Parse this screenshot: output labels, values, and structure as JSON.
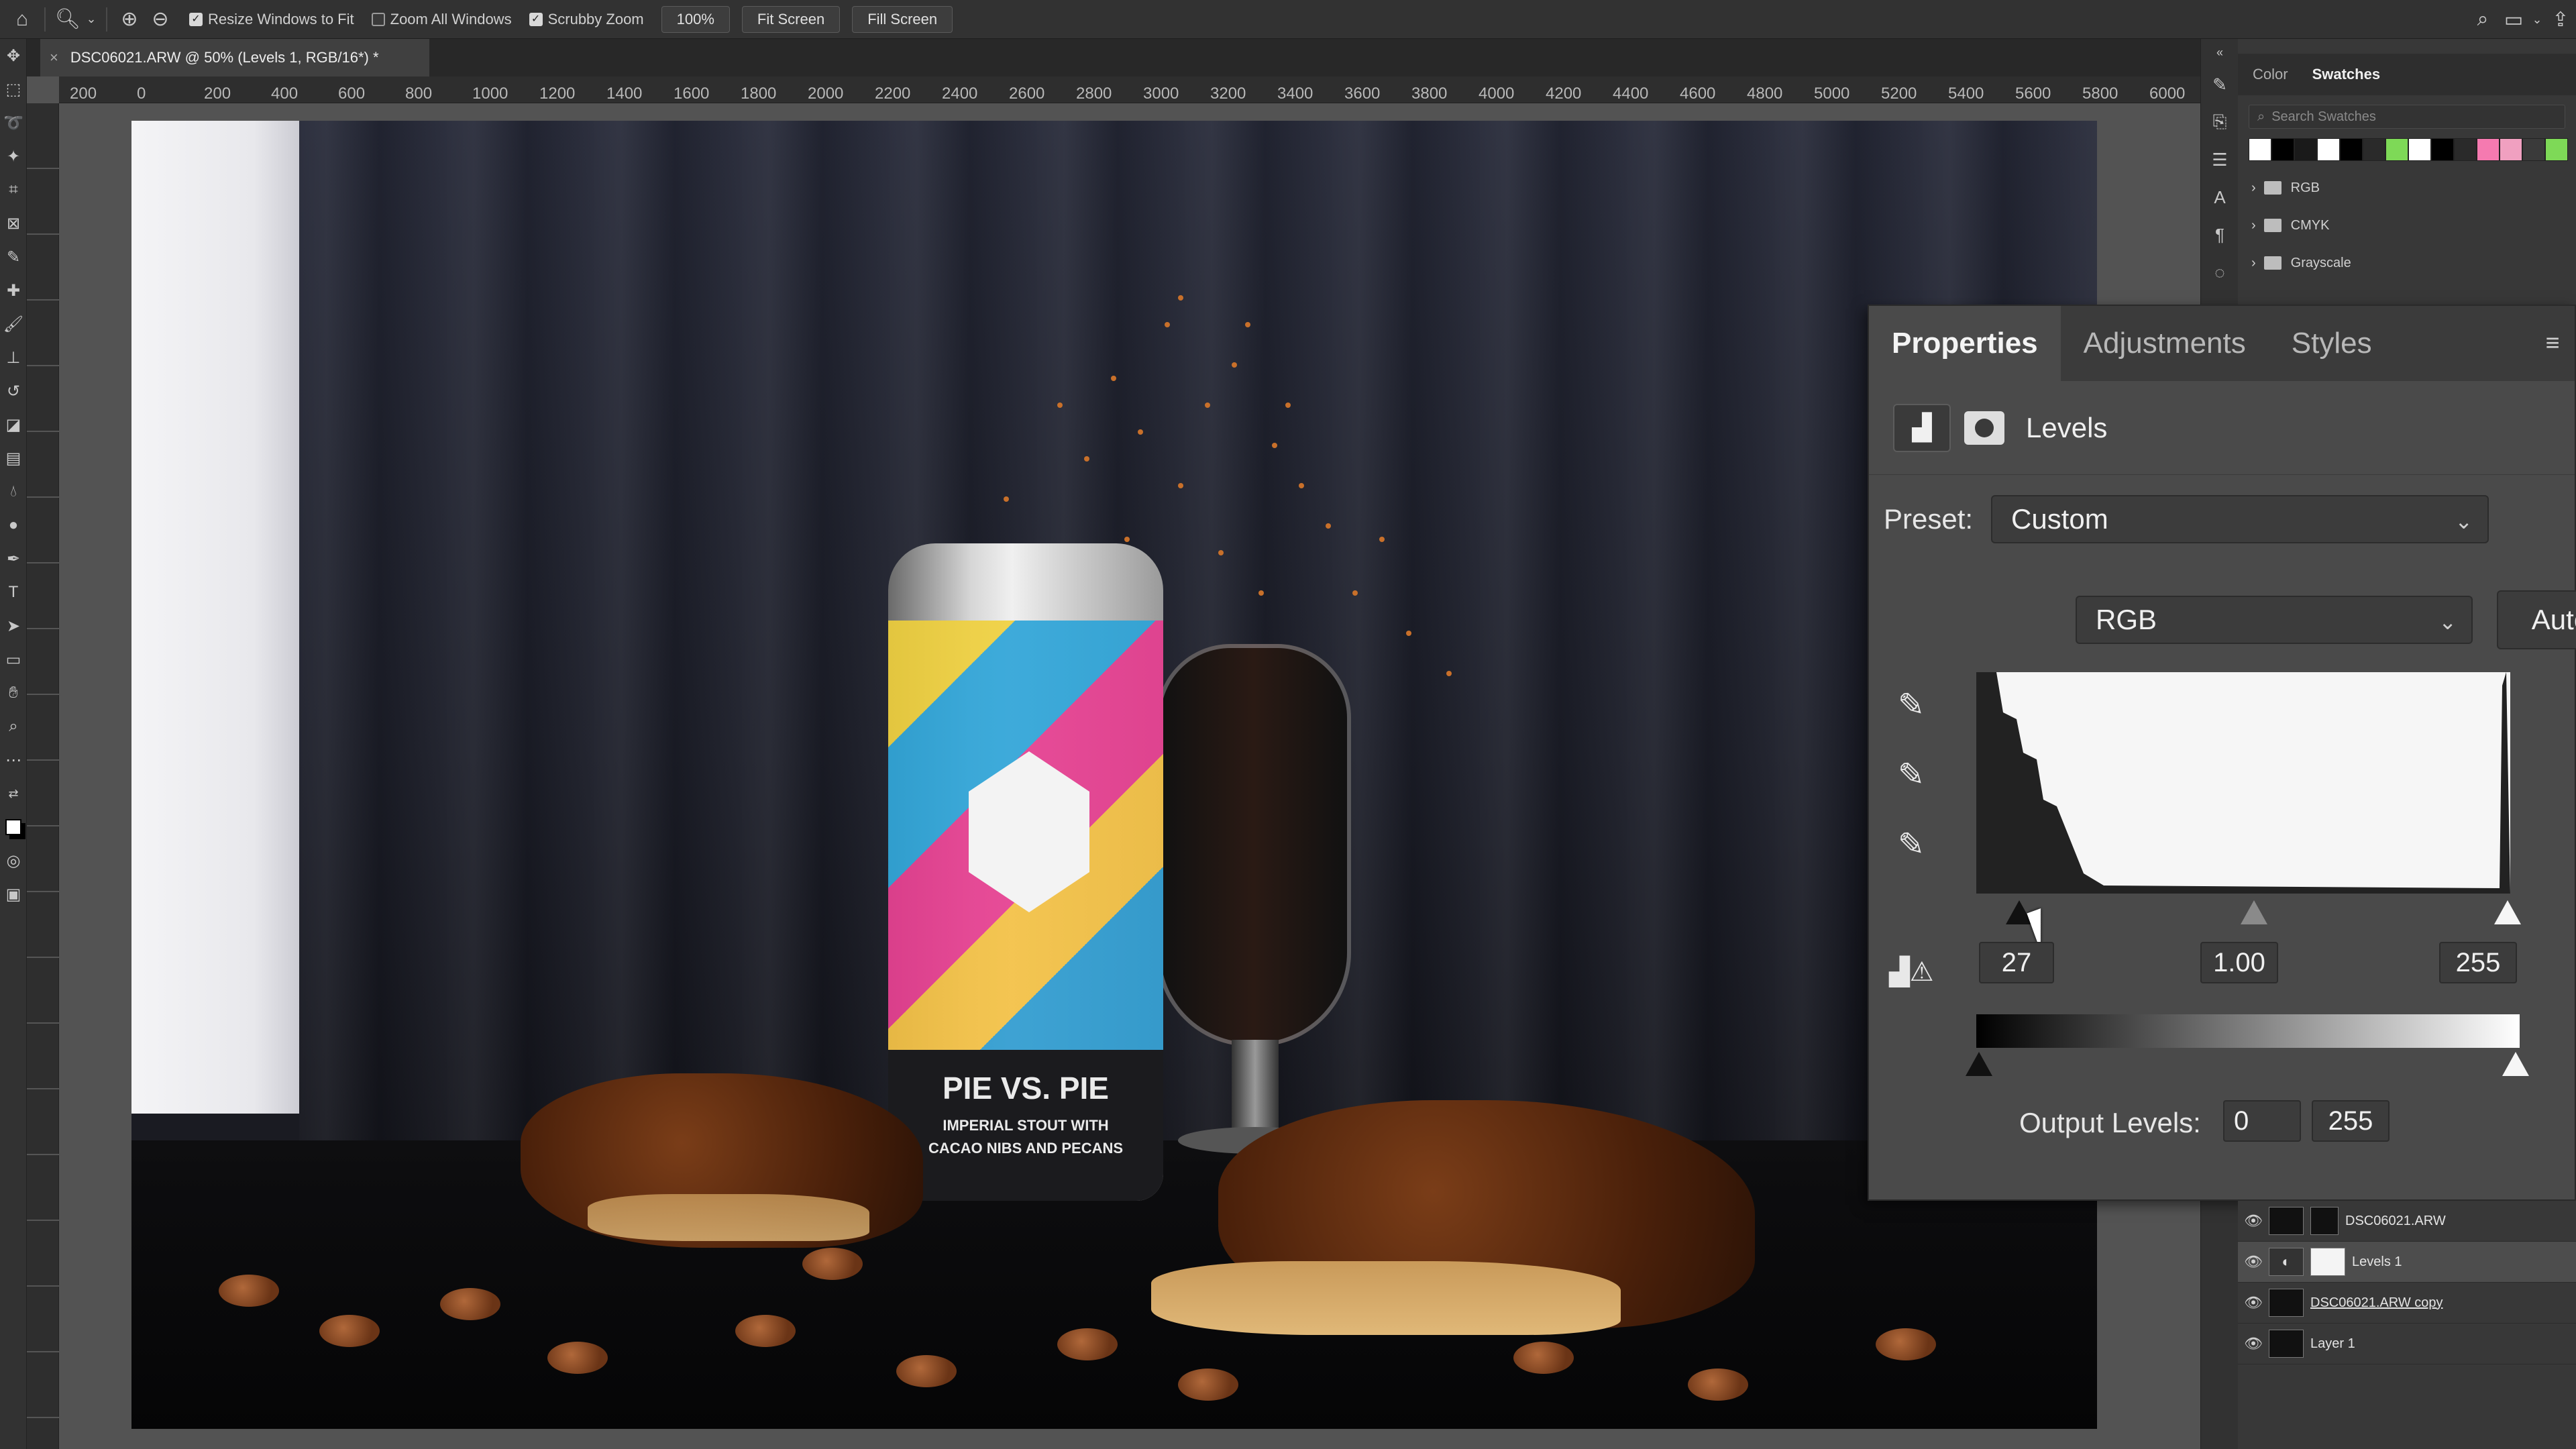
{
  "options_bar": {
    "home_icon": "home-icon",
    "zoom_tool_icon": "zoom-icon",
    "zoom_in_icon": "zoom-in-icon",
    "zoom_out_icon": "zoom-out-icon",
    "resize_windows": {
      "label": "Resize Windows to Fit",
      "checked": true
    },
    "zoom_all_windows": {
      "label": "Zoom All Windows",
      "checked": false
    },
    "scrubby_zoom": {
      "label": "Scrubby Zoom",
      "checked": true
    },
    "zoom_percent": "100%",
    "fit_screen": "Fit Screen",
    "fill_screen": "Fill Screen"
  },
  "document": {
    "tab_title": "DSC06021.ARW @ 50% (Levels 1, RGB/16*) *",
    "close_glyph": "×"
  },
  "ruler_top": [
    "200",
    "0",
    "200",
    "400",
    "600",
    "800",
    "1000",
    "1200",
    "1400",
    "1600",
    "1800",
    "2000",
    "2200",
    "2400",
    "2600",
    "2800",
    "3000",
    "3200",
    "3400",
    "3600",
    "3800",
    "4000",
    "4200",
    "4400",
    "4600",
    "4800",
    "5000",
    "5200",
    "5400",
    "5600",
    "5800",
    "6000"
  ],
  "photo": {
    "can_title": "PIE VS. PIE",
    "can_sub1": "IMPERIAL STOUT WITH",
    "can_sub2": "CACAO NIBS AND PECANS"
  },
  "swatches": {
    "tabs": [
      "Color",
      "Swatches"
    ],
    "active_tab": "Swatches",
    "search_placeholder": "Search Swatches",
    "chips": [
      "#ffffff",
      "#000000",
      "#1a1a1a",
      "#ffffff",
      "#000000",
      "#2a2a2a",
      "#7ed957",
      "#ffffff",
      "#000000",
      "#2a2a2a",
      "#f57ab0",
      "#f0a0c0",
      "#3a3a3a",
      "#7ed957"
    ],
    "folders": [
      "RGB",
      "CMYK",
      "Grayscale"
    ]
  },
  "properties": {
    "tabs": [
      "Properties",
      "Adjustments",
      "Styles"
    ],
    "active_tab": "Properties",
    "panel_title": "Levels",
    "preset_label": "Preset:",
    "preset_value": "Custom",
    "channel_value": "RGB",
    "auto_label": "Auto",
    "input_black": "27",
    "input_gamma": "1.00",
    "input_white": "255",
    "output_label": "Output Levels:",
    "output_black": "0",
    "output_white": "255"
  },
  "layers": [
    {
      "name": "DSC06021.ARW",
      "selected": false,
      "underline": false
    },
    {
      "name": "Levels 1",
      "selected": true,
      "underline": false
    },
    {
      "name": "DSC06021.ARW copy",
      "selected": false,
      "underline": true
    },
    {
      "name": "Layer 1",
      "selected": false,
      "underline": false
    }
  ]
}
